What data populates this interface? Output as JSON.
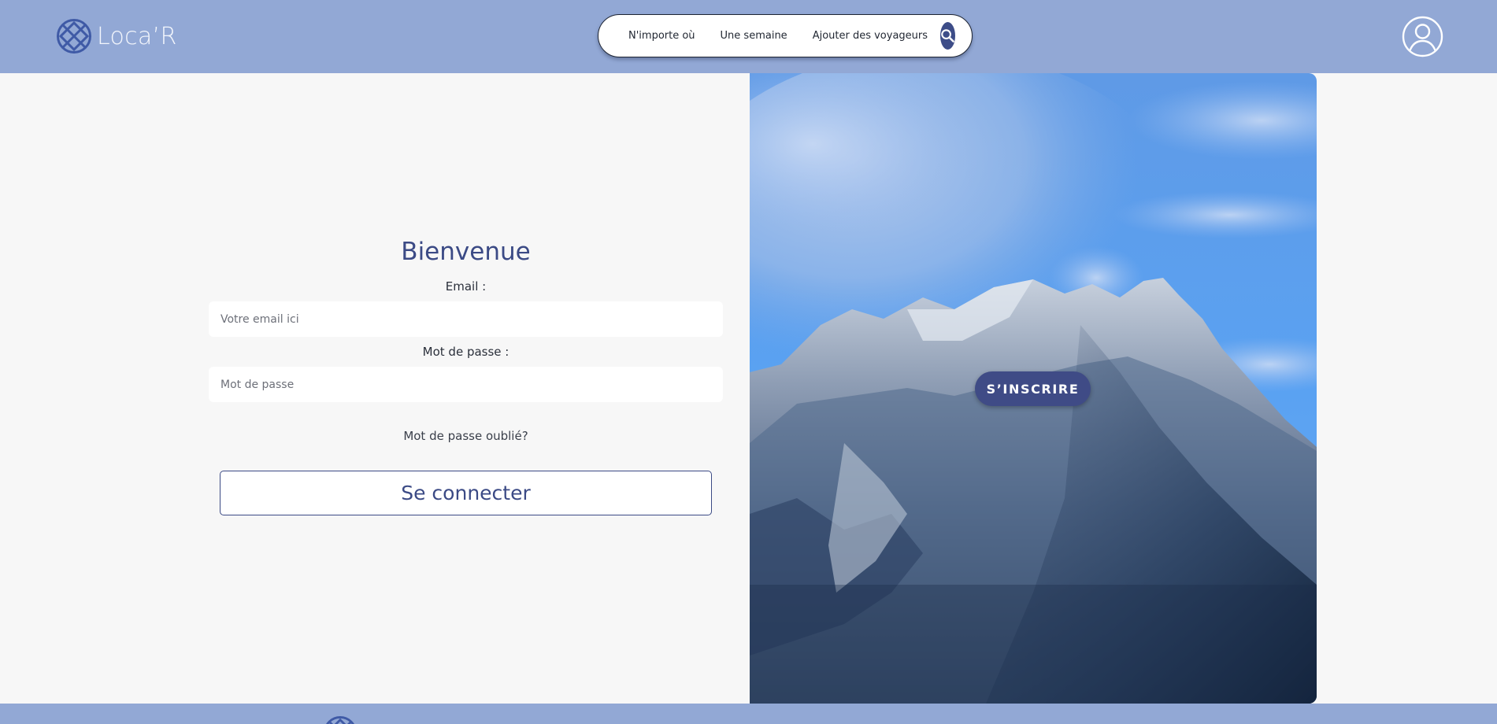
{
  "header": {
    "logo_text": "Loca’R",
    "search": {
      "where": "N'importe où",
      "when": "Une semaine",
      "who": "Ajouter des voyageurs",
      "button_icon": "search-icon"
    },
    "avatar_icon": "user-circle-icon"
  },
  "login": {
    "title": "Bienvenue",
    "email_label": "Email :",
    "email_placeholder": "Votre email ici",
    "password_label": "Mot de passe :",
    "password_placeholder": "Mot de passe",
    "forgot_link": "Mot de passe oublié?",
    "submit_label": "Se connecter"
  },
  "hero": {
    "image": "mountain-landscape",
    "signup_label": "S’INSCRIRE"
  },
  "colors": {
    "header_bg": "#92a8d5",
    "accent": "#3b4a85",
    "page_bg": "#f7f7f7"
  }
}
